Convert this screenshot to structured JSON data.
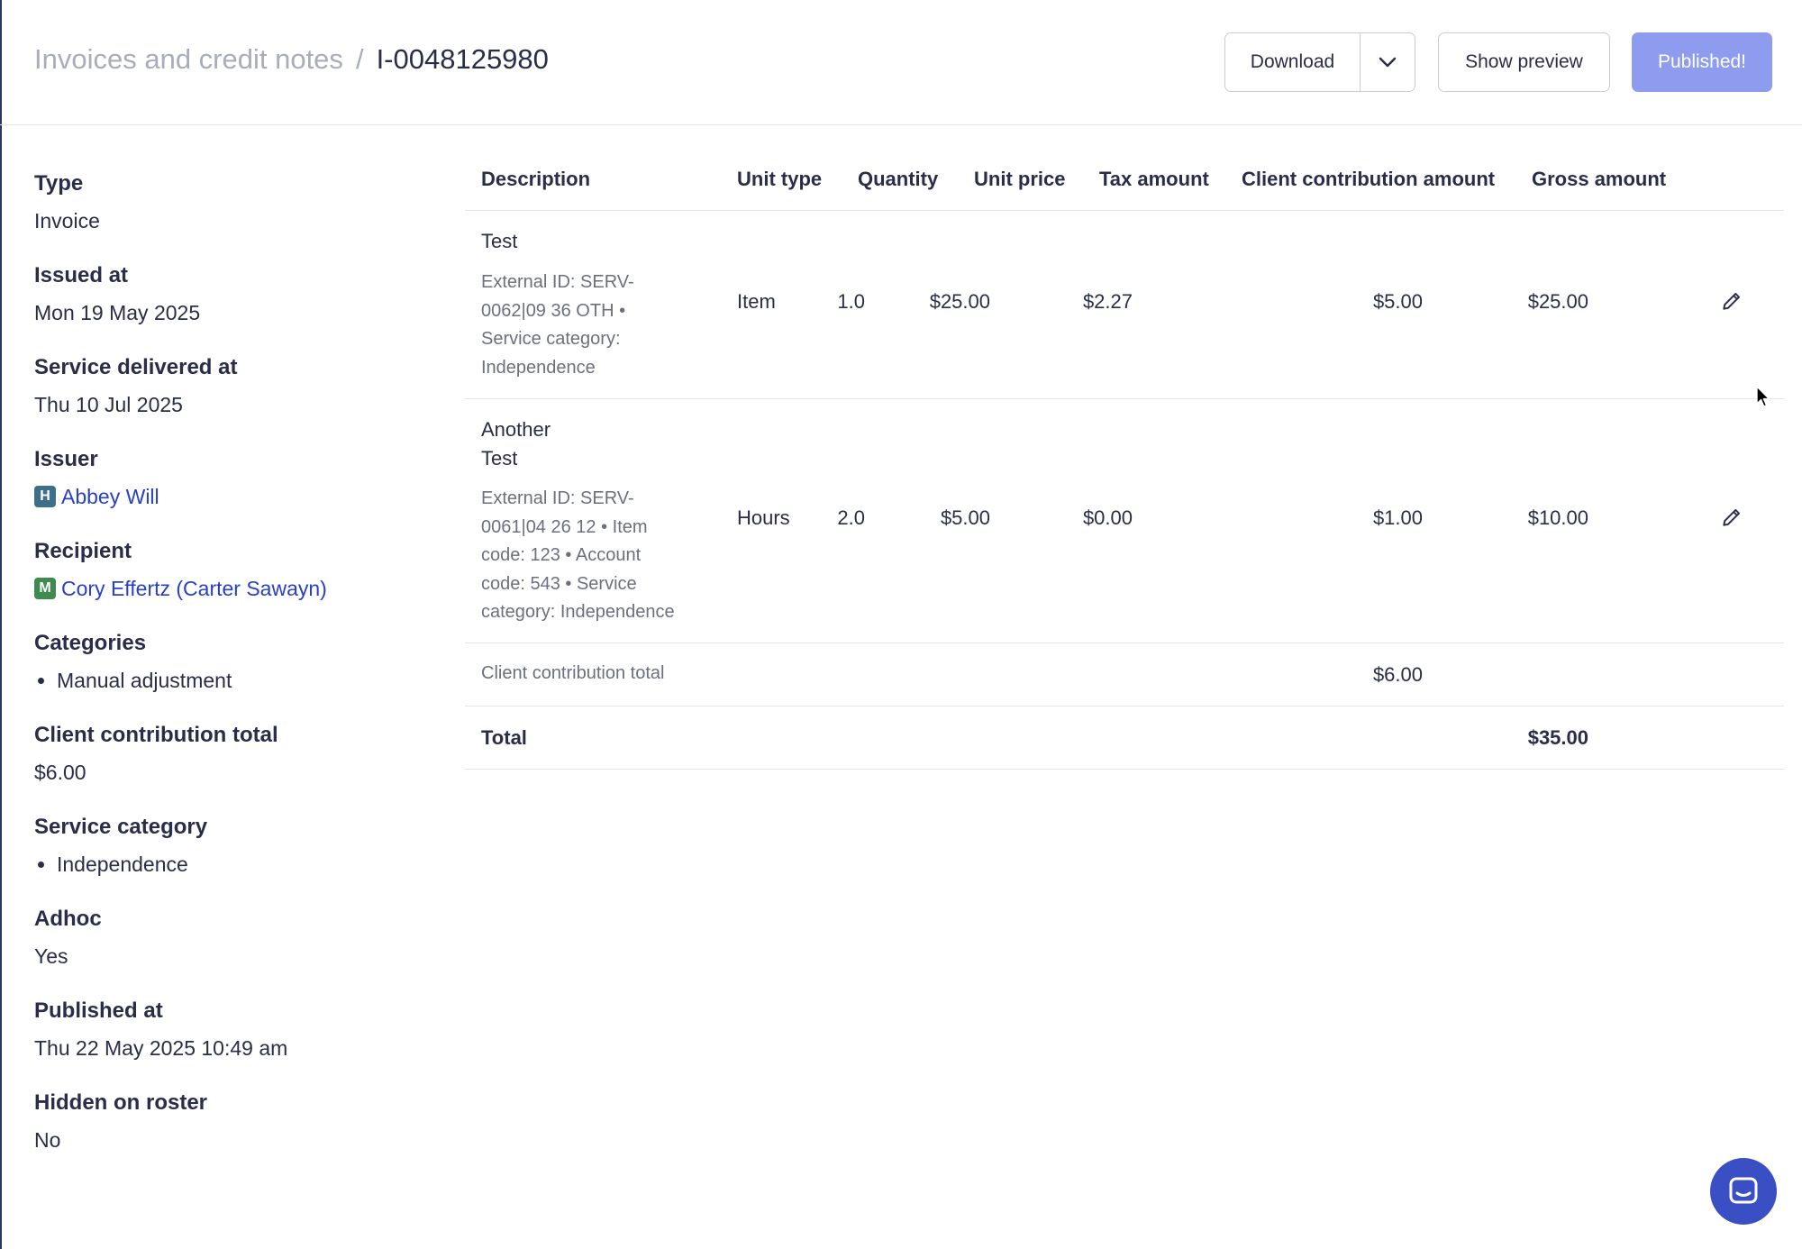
{
  "header": {
    "breadcrumb_parent": "Invoices and credit notes",
    "breadcrumb_sep": "/",
    "breadcrumb_current": "I-0048125980",
    "download_label": "Download",
    "preview_label": "Show preview",
    "published_label": "Published!"
  },
  "details": {
    "type": {
      "label": "Type",
      "value": "Invoice"
    },
    "issued_at": {
      "label": "Issued at",
      "value": "Mon 19 May 2025"
    },
    "service_delivered_at": {
      "label": "Service delivered at",
      "value": "Thu 10 Jul 2025"
    },
    "issuer": {
      "label": "Issuer",
      "badge": "H",
      "value": "Abbey Will"
    },
    "recipient": {
      "label": "Recipient",
      "badge": "M",
      "value": "Cory Effertz (Carter Sawayn)"
    },
    "categories": {
      "label": "Categories",
      "value": "Manual adjustment"
    },
    "client_contribution_total": {
      "label": "Client contribution total",
      "value": "$6.00"
    },
    "service_category": {
      "label": "Service category",
      "value": "Independence"
    },
    "adhoc": {
      "label": "Adhoc",
      "value": "Yes"
    },
    "published_at": {
      "label": "Published at",
      "value": "Thu 22 May 2025 10:49 am"
    },
    "hidden_on_roster": {
      "label": "Hidden on roster",
      "value": "No"
    }
  },
  "table": {
    "columns": {
      "description": "Description",
      "unit_type": "Unit type",
      "quantity": "Quantity",
      "unit_price": "Unit price",
      "tax_amount": "Tax amount",
      "client_contribution": "Client contribution amount",
      "gross_amount": "Gross amount"
    },
    "rows": [
      {
        "title_lines": [
          "Test"
        ],
        "meta_lines": [
          "External ID: SERV-",
          "0062|09 36 OTH •",
          "Service category:",
          "Independence"
        ],
        "unit_type": "Item",
        "quantity": "1.0",
        "unit_price": "$25.00",
        "tax_amount": "$2.27",
        "client_contribution": "$5.00",
        "gross_amount": "$25.00"
      },
      {
        "title_lines": [
          "Another",
          "Test"
        ],
        "meta_lines": [
          "External ID: SERV-",
          "0061|04 26 12 • Item",
          "code: 123 • Account",
          "code: 543 • Service",
          "category: Independence"
        ],
        "unit_type": "Hours",
        "quantity": "2.0",
        "unit_price": "$5.00",
        "tax_amount": "$0.00",
        "client_contribution": "$1.00",
        "gross_amount": "$10.00"
      }
    ],
    "subtotal": {
      "label": "Client contribution total",
      "value": "$6.00"
    },
    "total": {
      "label": "Total",
      "value": "$35.00"
    }
  },
  "icons": {
    "download_caret": "chevron-down-icon",
    "edit": "pencil-icon",
    "chat": "chat-icon"
  }
}
